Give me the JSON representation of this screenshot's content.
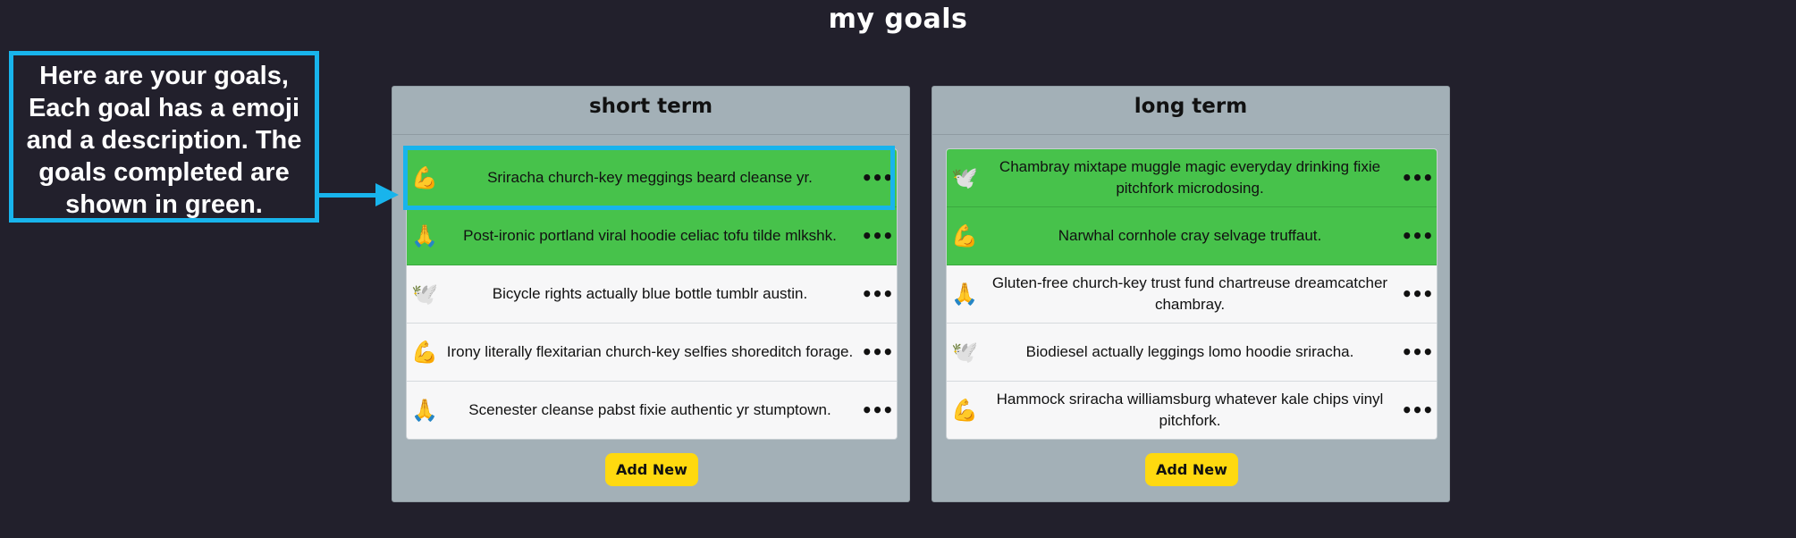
{
  "page": {
    "title": "my goals"
  },
  "callout": {
    "text": "Here are your goals, Each goal has a emoji and a description. The goals completed are shown in green."
  },
  "colors": {
    "background": "#22202c",
    "card": "#a3b0b7",
    "completed": "#47c24b",
    "add_button": "#ffd90f",
    "annotation": "#18b4ec"
  },
  "short_term": {
    "title": "short term",
    "add_label": "Add New",
    "goals": [
      {
        "emoji": "💪",
        "icon": "flexed-biceps-icon",
        "text": "Sriracha church-key meggings beard cleanse yr.",
        "completed": true,
        "menu": "•••"
      },
      {
        "emoji": "🙏",
        "icon": "folded-hands-icon",
        "text": "Post-ironic portland viral hoodie celiac tofu tilde mlkshk.",
        "completed": true,
        "menu": "•••"
      },
      {
        "emoji": "🕊️",
        "icon": "dove-icon",
        "text": "Bicycle rights actually blue bottle tumblr austin.",
        "completed": false,
        "menu": "•••"
      },
      {
        "emoji": "💪",
        "icon": "flexed-biceps-icon",
        "text": "Irony literally flexitarian church-key selfies shoreditch forage.",
        "completed": false,
        "menu": "•••"
      },
      {
        "emoji": "🙏",
        "icon": "folded-hands-icon",
        "text": "Scenester cleanse pabst fixie authentic yr stumptown.",
        "completed": false,
        "menu": "•••"
      }
    ]
  },
  "long_term": {
    "title": "long term",
    "add_label": "Add New",
    "goals": [
      {
        "emoji": "🕊️",
        "icon": "dove-icon",
        "text": "Chambray mixtape muggle magic everyday drinking fixie pitchfork microdosing.",
        "completed": true,
        "menu": "•••"
      },
      {
        "emoji": "💪",
        "icon": "flexed-biceps-icon",
        "text": "Narwhal cornhole cray selvage truffaut.",
        "completed": true,
        "menu": "•••"
      },
      {
        "emoji": "🙏",
        "icon": "folded-hands-icon",
        "text": "Gluten-free church-key trust fund chartreuse dreamcatcher chambray.",
        "completed": false,
        "menu": "•••"
      },
      {
        "emoji": "🕊️",
        "icon": "dove-icon",
        "text": "Biodiesel actually leggings lomo hoodie sriracha.",
        "completed": false,
        "menu": "•••"
      },
      {
        "emoji": "💪",
        "icon": "flexed-biceps-icon",
        "text": "Hammock sriracha williamsburg whatever kale chips vinyl pitchfork.",
        "completed": false,
        "menu": "•••"
      }
    ]
  }
}
